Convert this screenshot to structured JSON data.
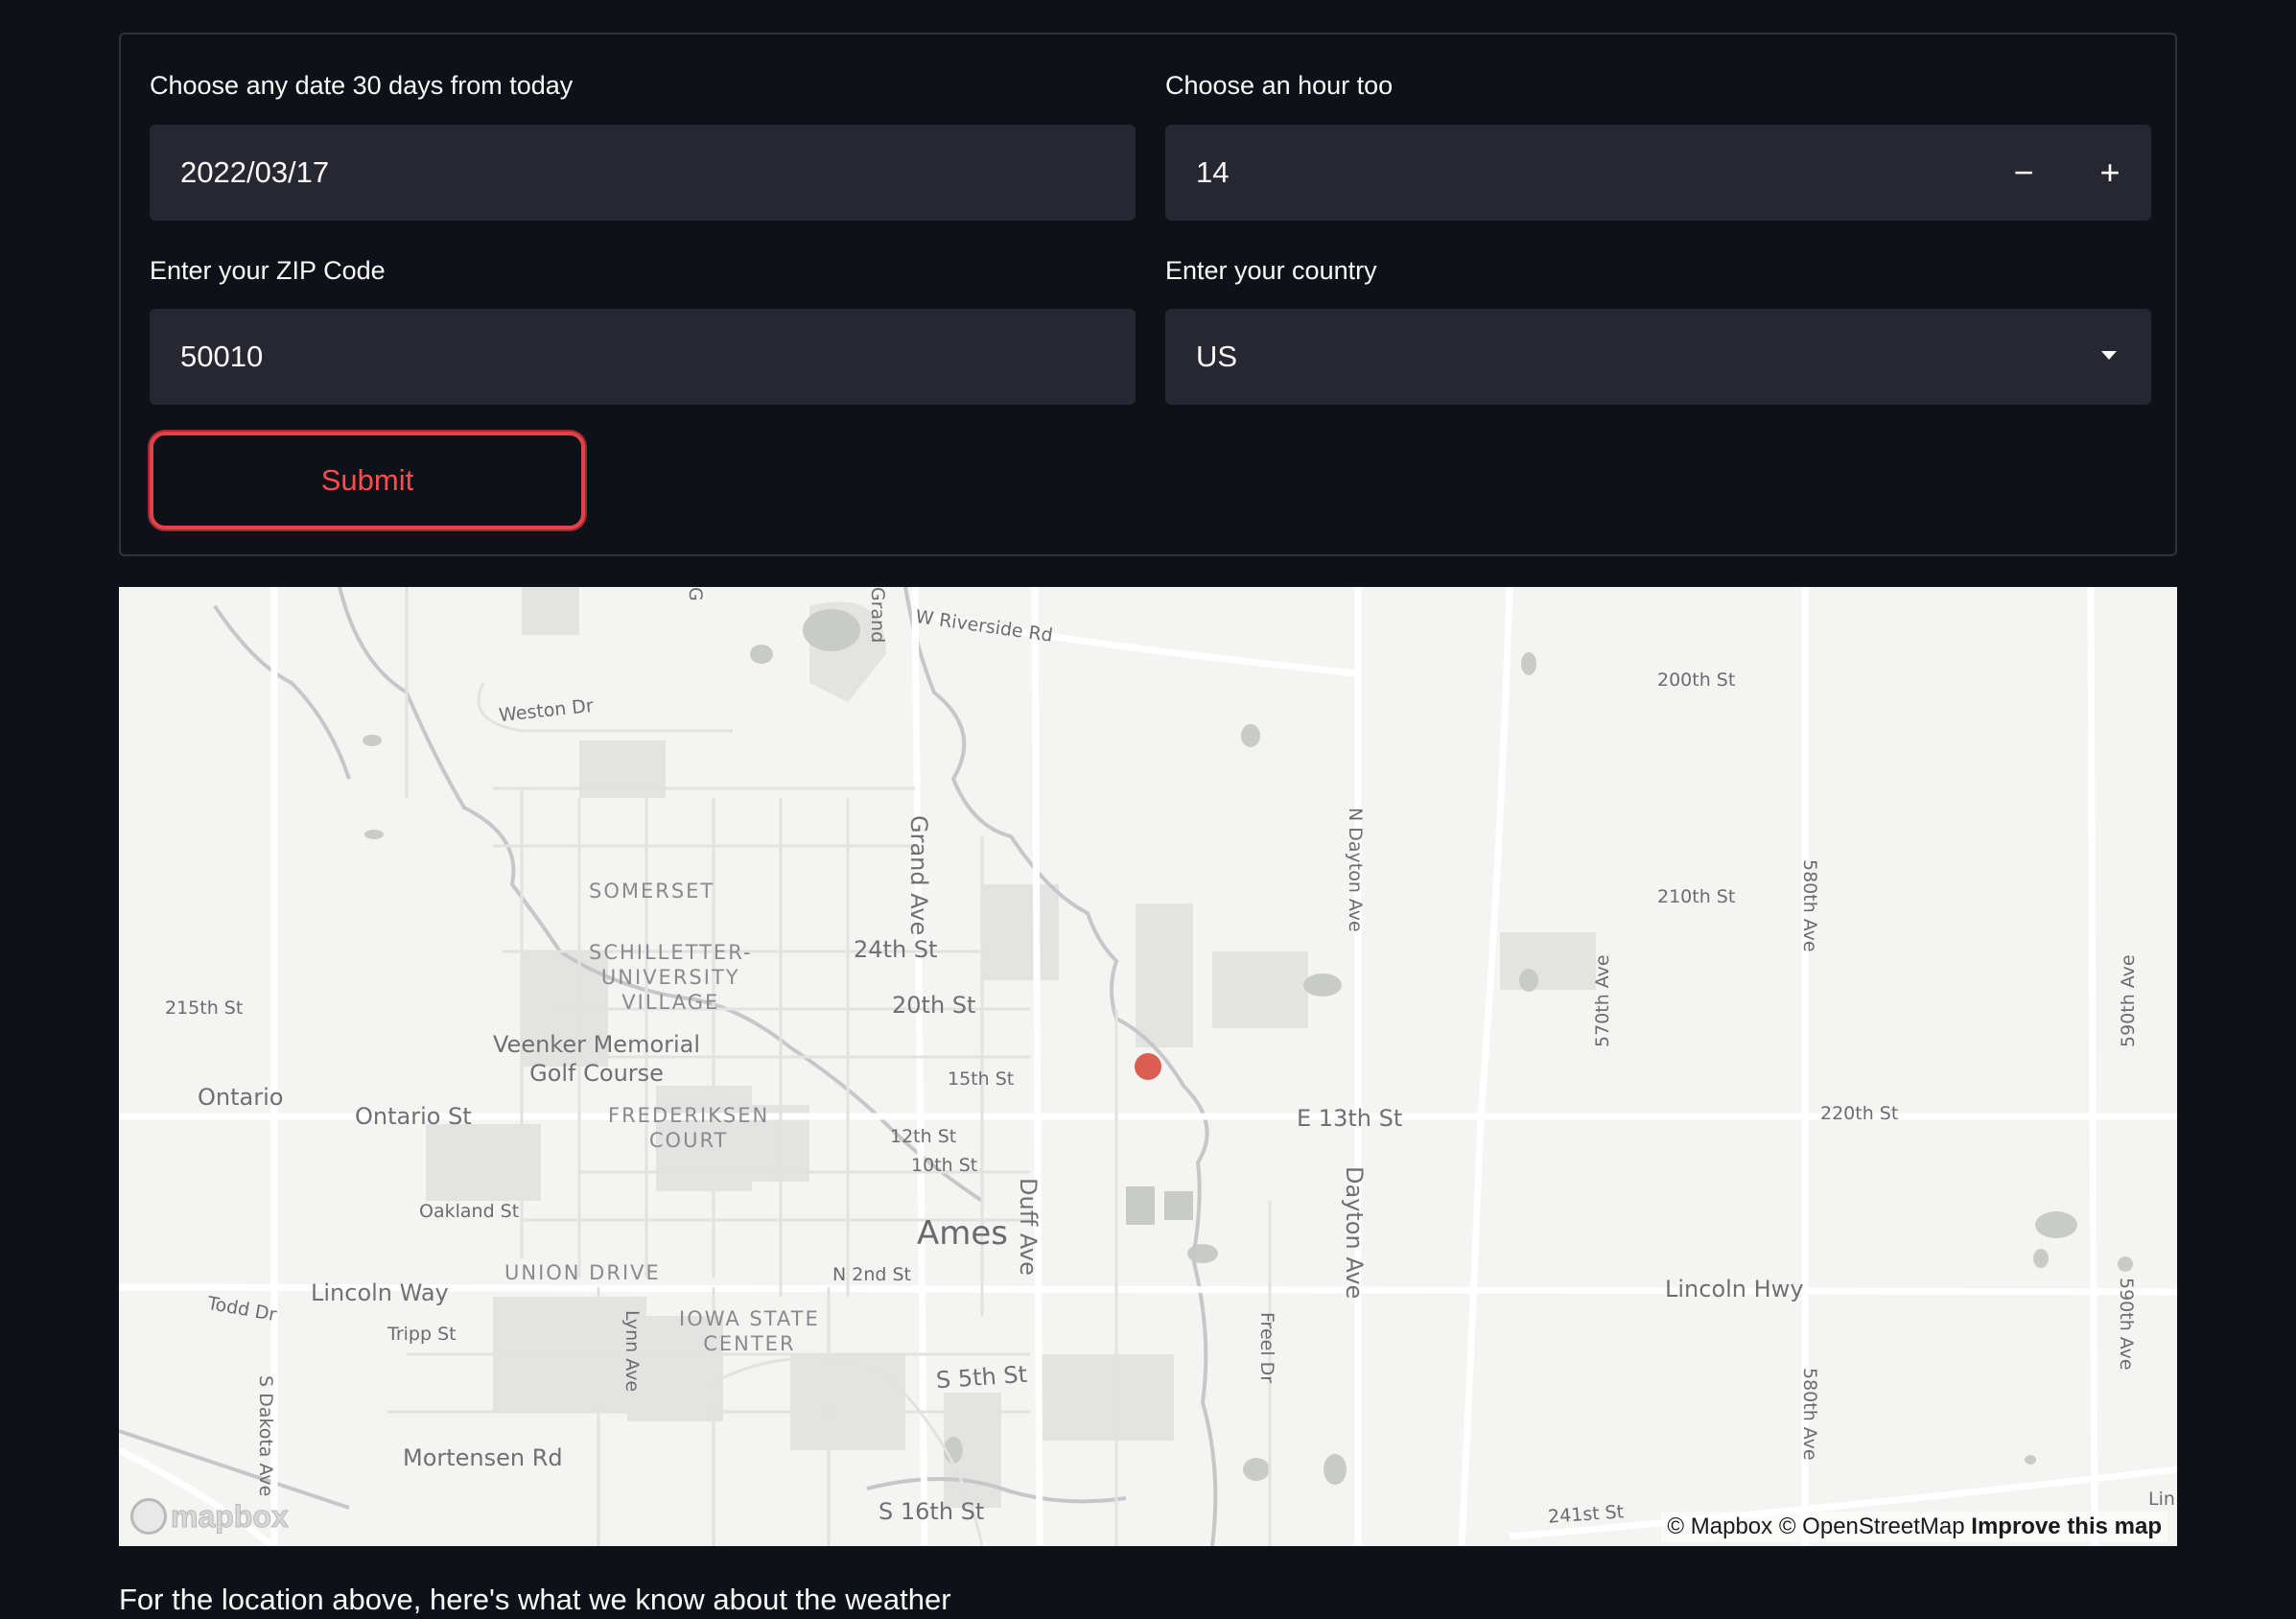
{
  "form": {
    "date_label": "Choose any date 30 days from today",
    "date_value": "2022/03/17",
    "hour_label": "Choose an hour too",
    "hour_value": "14",
    "hour_minus": "−",
    "hour_plus": "+",
    "zip_label": "Enter your ZIP Code",
    "zip_value": "50010",
    "country_label": "Enter your country",
    "country_value": "US",
    "submit_label": "Submit"
  },
  "map": {
    "labels": {
      "w_riverside": "W Riverside Rd",
      "weston": "Weston Dr",
      "somerset": "SOMERSET",
      "schilletter": "SCHILLETTER-\nUNIVERSITY\nVILLAGE",
      "veenker": "Veenker Memorial\nGolf Course",
      "ontario_city": "Ontario",
      "ontario_st": "Ontario St",
      "frederiksen": "FREDERIKSEN\nCOURT",
      "oakland": "Oakland St",
      "union_drive": "UNION DRIVE",
      "lincoln_way": "Lincoln Way",
      "todd": "Todd Dr",
      "tripp": "Tripp St",
      "iowa_state": "IOWA STATE\nCENTER",
      "mortensen": "Mortensen Rd",
      "s_dakota": "S Dakota Ave",
      "lynn": "Lynn Ave",
      "grand_ave": "Grand Ave",
      "grand_top": "Grand",
      "g_top": "G",
      "st_24": "24th St",
      "st_20": "20th St",
      "st_15": "15th St",
      "st_12": "12th St",
      "st_10": "10th St",
      "ames": "Ames",
      "n2nd": "N 2nd St",
      "s5th": "S 5th St",
      "s16th": "S 16th St",
      "duff": "Duff Ave",
      "freel": "Freel Dr",
      "e13th": "E 13th St",
      "n_dayton": "N Dayton Ave",
      "dayton": "Dayton Ave",
      "st_200": "200th St",
      "st_210": "210th St",
      "st_220": "220th St",
      "st_215": "215th St",
      "ave_570": "570th Ave",
      "ave_580a": "580th Ave",
      "ave_580b": "580th Ave",
      "ave_590a": "590th Ave",
      "ave_590b": "590th Ave",
      "lincoln_hwy": "Lincoln Hwy",
      "st_241": "241st St",
      "lin": "Lin"
    },
    "logo_text": "mapbox",
    "attribution": "© Mapbox © OpenStreetMap",
    "improve_link": "Improve this map",
    "marker_color": "#d9554a"
  },
  "footer": {
    "text": "For the location above, here's what we know about the weather"
  },
  "colors": {
    "background": "#0e1117",
    "input_bg": "#262730",
    "accent": "#ff4b4b"
  }
}
